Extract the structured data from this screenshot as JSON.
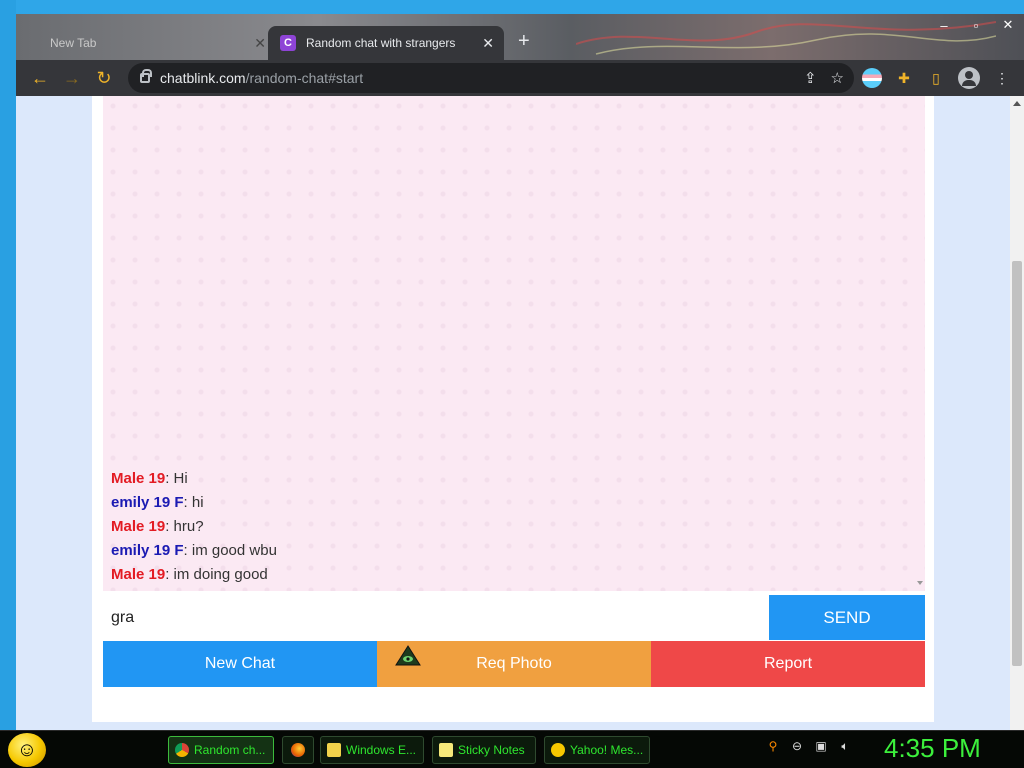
{
  "browser": {
    "tabs": [
      {
        "label": "New Tab",
        "active": false
      },
      {
        "label": "Random chat with strangers",
        "active": true,
        "favicon": "C"
      }
    ],
    "url_host": "chatblink.com",
    "url_path": "/random-chat#start"
  },
  "chat": {
    "messages": [
      {
        "sender": "Male 19",
        "gender": "male",
        "text": ": Hi"
      },
      {
        "sender": "emily 19 F",
        "gender": "female",
        "text": ": hi"
      },
      {
        "sender": "Male 19",
        "gender": "male",
        "text": ": hru?"
      },
      {
        "sender": "emily 19 F",
        "gender": "female",
        "text": ": im good wbu"
      },
      {
        "sender": "Male 19",
        "gender": "male",
        "text": ": im doing good"
      }
    ],
    "input_value": "gra",
    "send_label": "SEND",
    "actions": {
      "new_chat": "New Chat",
      "req_photo": "Req Photo",
      "report": "Report"
    }
  },
  "colors": {
    "send": "#2196f3",
    "new_chat": "#2196f3",
    "req_photo": "#f0a040",
    "report": "#ef4848",
    "male": "#e31b23",
    "female": "#1b1bb3"
  },
  "taskbar": {
    "items": [
      {
        "label": "Random ch...",
        "icon": "chrome-icon"
      },
      {
        "label": "",
        "icon": "firefox-icon"
      },
      {
        "label": "Windows E...",
        "icon": "folder-icon"
      },
      {
        "label": "Sticky Notes",
        "icon": "sticky-notes-icon"
      },
      {
        "label": "Yahoo! Mes...",
        "icon": "yahoo-messenger-icon"
      }
    ],
    "clock": "4:35 PM"
  }
}
